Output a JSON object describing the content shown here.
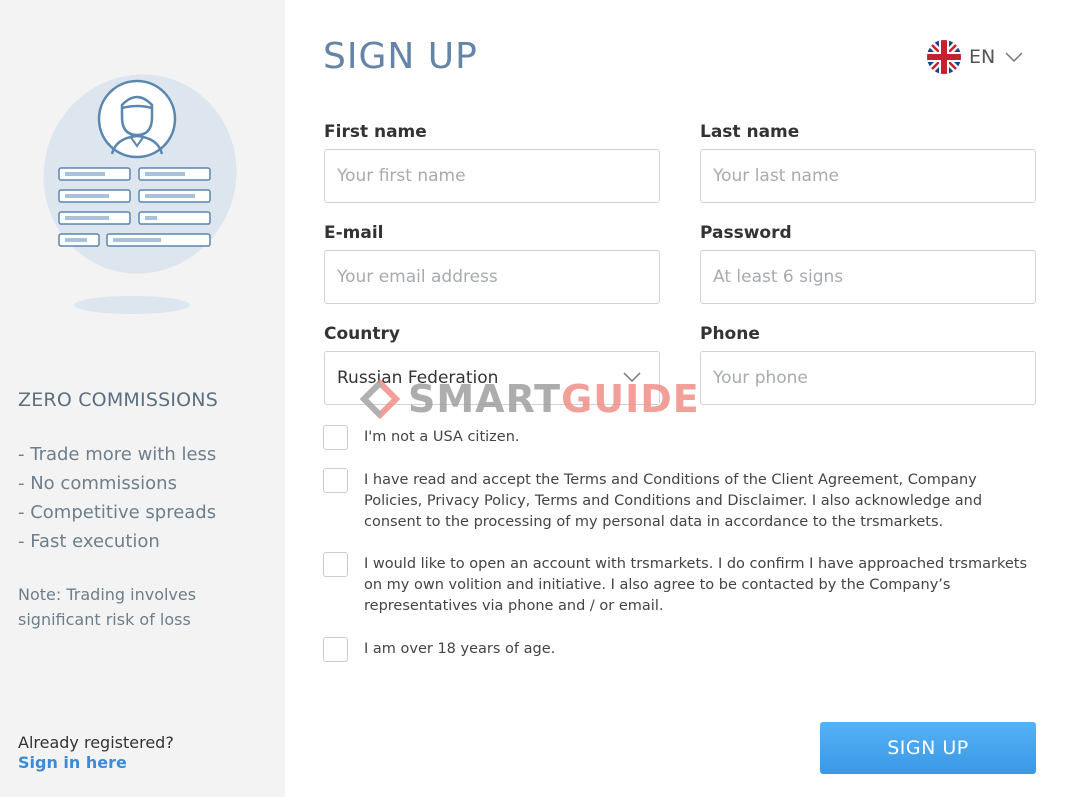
{
  "sidebar": {
    "heading": "ZERO COMMISSIONS",
    "features": [
      "- Trade more with less",
      "- No commissions",
      "- Competitive spreads",
      "- Fast execution"
    ],
    "note": "Note: Trading involves significant risk of loss",
    "already_registered": "Already registered?",
    "sign_in_link": "Sign in here"
  },
  "header": {
    "title": "SIGN UP",
    "language": {
      "label": "EN",
      "icon": "uk-flag-icon"
    }
  },
  "form": {
    "first_name": {
      "label": "First name",
      "placeholder": "Your first name",
      "value": ""
    },
    "last_name": {
      "label": "Last name",
      "placeholder": "Your last name",
      "value": ""
    },
    "email": {
      "label": "E-mail",
      "placeholder": "Your email address",
      "value": ""
    },
    "password": {
      "label": "Password",
      "placeholder": "At least 6 signs",
      "value": ""
    },
    "country": {
      "label": "Country",
      "value": "Russian Federation"
    },
    "phone": {
      "label": "Phone",
      "placeholder": "Your phone",
      "value": ""
    },
    "checkboxes": [
      {
        "text": "I'm not a USA citizen.",
        "checked": false
      },
      {
        "text": "I have read and accept the Terms and Conditions of the Client Agreement, Company Policies, Privacy Policy, Terms and Conditions and Disclaimer. I also acknowledge and consent to the processing of my personal data in accordance to the trsmarkets.",
        "checked": false
      },
      {
        "text": "I would like to open an account with trsmarkets. I do confirm I have approached trsmarkets on my own volition and initiative. I also agree to be contacted by the Company’s representatives via phone and / or email.",
        "checked": false
      },
      {
        "text": "I am over 18 years of age.",
        "checked": false
      }
    ],
    "submit_label": "SIGN UP"
  },
  "watermark": {
    "part1": "SMART",
    "part2": "GUIDE"
  },
  "colors": {
    "accent": "#3d8ad6",
    "title": "#6485a6",
    "button": "#42a1ee",
    "sidebar_bg": "#f3f3f3"
  }
}
